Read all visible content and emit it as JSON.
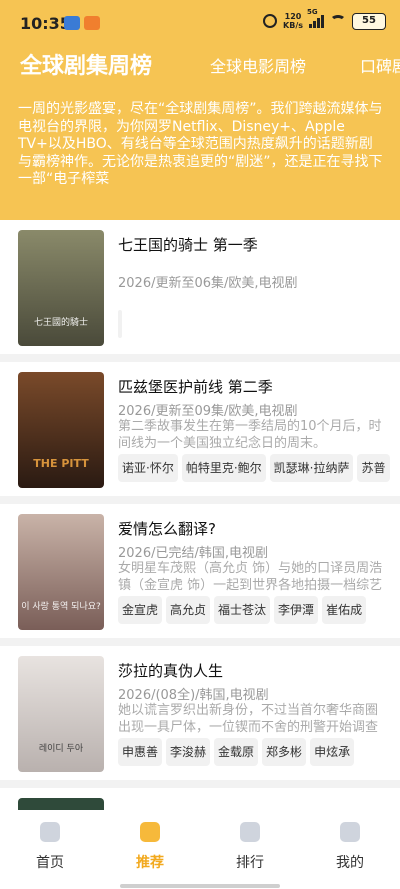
{
  "status_bar": {
    "time": "10:35",
    "net_speed_value": "120",
    "net_speed_unit": "KB/s",
    "network": "5G",
    "battery": "55"
  },
  "tabs": [
    {
      "label": "全球剧集周榜",
      "active": true
    },
    {
      "label": "全球电影周榜",
      "active": false
    },
    {
      "label": "口碑剧",
      "active": false
    }
  ],
  "header": {
    "description": "一周的光影盛宴，尽在“全球剧集周榜”。我们跨越流媒体与电视台的界限，为你网罗Netflix、Disney+、Apple TV+以及HBO、有线台等全球范围内热度飙升的话题新剧与霸榜神作。无论你是热衷追更的“剧迷”，还是正在寻找下一部“电子榨菜"
  },
  "shows": [
    {
      "title": "七王国的骑士 第一季",
      "meta": "2026/更新至06集/欧美,电视剧",
      "description": "",
      "cast": [],
      "poster_caption": "七王國的騎士",
      "poster_colors": [
        "#8a8a6a",
        "#4a4a3a"
      ]
    },
    {
      "title": "匹兹堡医护前线 第二季",
      "meta": "2026/更新至09集/欧美,电视剧",
      "description": "第二季故事发生在第一季结局的10个月后，时间线为一个美国独立纪念日的周末。",
      "cast": [
        "诺亚·怀尔",
        "帕特里克·鲍尔",
        "凯瑟琳·拉纳萨",
        "苏普"
      ],
      "poster_caption": "THE PITT",
      "poster_colors": [
        "#7a4a2a",
        "#2a1a12"
      ]
    },
    {
      "title": "爱情怎么翻译?",
      "meta": "2026/已完结/韩国,电视剧",
      "description": "女明星车茂熙（高允贞 饰）与她的口译员周浩镇（金宣虎 饰）一起到世界各地拍摄一档综艺",
      "cast": [
        "金宣虎",
        "高允贞",
        "福士苍汰",
        "李伊潭",
        "崔佑成"
      ],
      "poster_caption": "이 사랑 통역 되나요?",
      "poster_colors": [
        "#c9b3a8",
        "#7a5e58"
      ]
    },
    {
      "title": "莎拉的真伪人生",
      "meta": "2026/(08全)/韩国,电视剧",
      "description": "她以谎言罗织出新身份，不过当首尔奢华商圈出现一具尸体，一位锲而不舍的刑警开始调查",
      "cast": [
        "申惠善",
        "李浚赫",
        "金载原",
        "郑多彬",
        "申炫承"
      ],
      "poster_caption": "레이디 두아",
      "poster_colors": [
        "#e8e3e0",
        "#b9b1ae"
      ]
    }
  ],
  "nav": [
    {
      "label": "首页",
      "active": false
    },
    {
      "label": "推荐",
      "active": true
    },
    {
      "label": "排行",
      "active": false
    },
    {
      "label": "我的",
      "active": false
    }
  ],
  "colors": {
    "header_bg": "#f6c453",
    "accent": "#f2a91e",
    "card_bg": "#ffffff",
    "page_bg": "#f2f2f2"
  }
}
